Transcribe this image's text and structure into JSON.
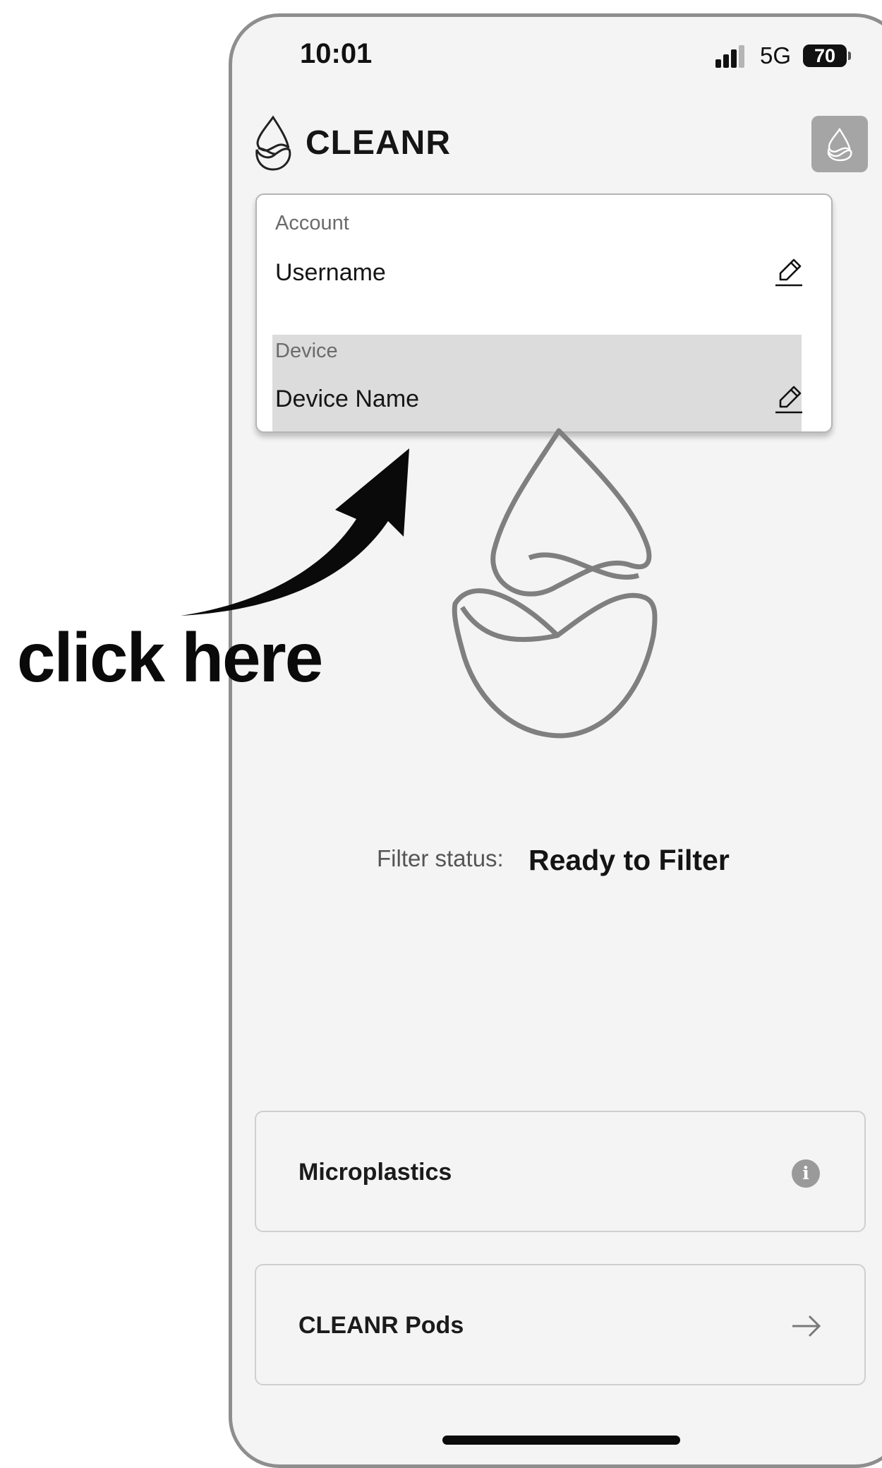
{
  "status_bar": {
    "time": "10:01",
    "network": "5G",
    "battery": "70"
  },
  "header": {
    "app_name": "CLEANR"
  },
  "menu": {
    "account_label": "Account",
    "username": "Username",
    "device_label": "Device",
    "device_name": "Device Name"
  },
  "annotation": {
    "text": "click here"
  },
  "filter": {
    "label": "Filter status:",
    "value": "Ready to Filter"
  },
  "cards": [
    {
      "label": "Microplastics",
      "icon": "info-icon"
    },
    {
      "label": "CLEANR Pods",
      "icon": "arrow-right-icon"
    }
  ]
}
